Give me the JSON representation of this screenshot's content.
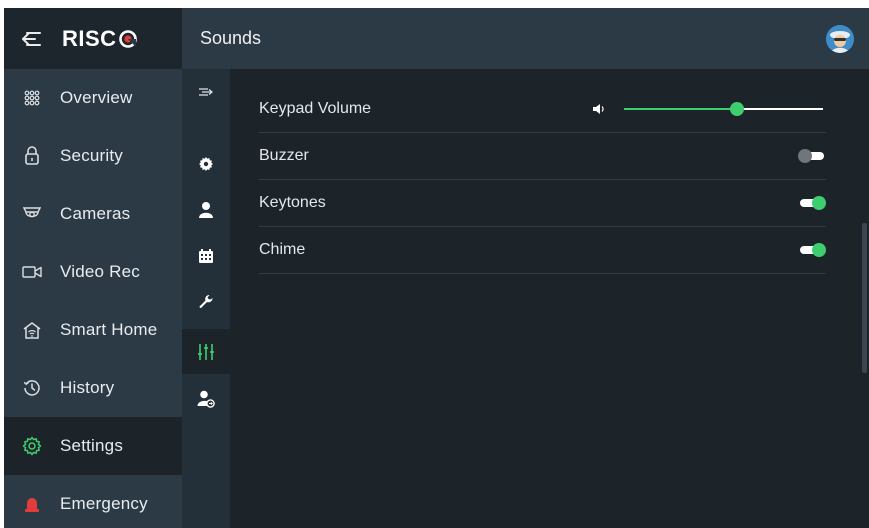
{
  "app": {
    "logo_text": "RISC",
    "accent_color": "#3fce6f",
    "brand_color": "#e23c3c"
  },
  "sidebar": {
    "back_icon": "collapse-arrow-icon",
    "items": [
      {
        "label": "Overview",
        "icon": "grid-dots-icon",
        "active": false
      },
      {
        "label": "Security",
        "icon": "lock-icon",
        "active": false
      },
      {
        "label": "Cameras",
        "icon": "camera-icon",
        "active": false
      },
      {
        "label": "Video Rec",
        "icon": "video-recorder-icon",
        "active": false
      },
      {
        "label": "Smart Home",
        "icon": "smart-home-icon",
        "active": false
      },
      {
        "label": "History",
        "icon": "history-clock-icon",
        "active": false
      },
      {
        "label": "Settings",
        "icon": "gear-icon",
        "active": true
      },
      {
        "label": "Emergency",
        "icon": "siren-icon",
        "active": false
      }
    ]
  },
  "header": {
    "title": "Sounds",
    "avatar_icon": "user-avatar-icon"
  },
  "subnav": {
    "items": [
      {
        "icon": "expand-arrow-icon",
        "active": false
      },
      {
        "icon": "cog-icon",
        "active": false
      },
      {
        "icon": "user-icon",
        "active": false
      },
      {
        "icon": "calendar-icon",
        "active": false
      },
      {
        "icon": "wrench-icon",
        "active": false
      },
      {
        "icon": "sliders-icon",
        "active": true
      },
      {
        "icon": "user-transfer-icon",
        "active": false
      }
    ]
  },
  "sounds": {
    "volume": {
      "label": "Keypad Volume",
      "icon": "speaker-icon",
      "level": 0.57
    },
    "toggles": [
      {
        "label": "Buzzer",
        "on": false
      },
      {
        "label": "Keytones",
        "on": true
      },
      {
        "label": "Chime",
        "on": true
      }
    ]
  }
}
